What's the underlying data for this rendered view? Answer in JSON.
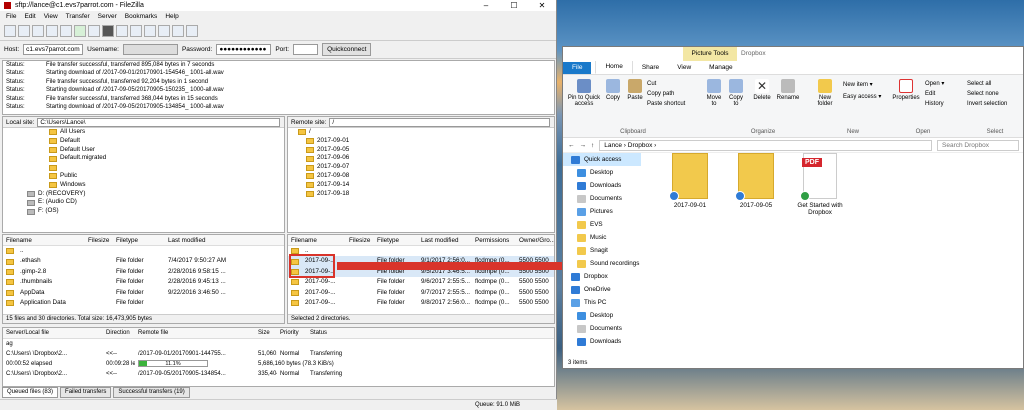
{
  "filezilla": {
    "title": "sftp://lance@c1.evs7parrot.com - FileZilla",
    "menu": [
      "File",
      "Edit",
      "View",
      "Transfer",
      "Server",
      "Bookmarks",
      "Help"
    ],
    "quickconnect": {
      "host_label": "Host:",
      "host": "c1.evs7parrot.com",
      "user_label": "Username:",
      "user": "",
      "pass_label": "Password:",
      "pass": "●●●●●●●●●●●●",
      "port_label": "Port:",
      "port": "",
      "button": "Quickconnect"
    },
    "log": [
      {
        "k": "Status:",
        "v": "File transfer successful, transferred 895,084 bytes in 7 seconds"
      },
      {
        "k": "Status:",
        "v": "Starting download of /2017-09-01/20170901-154546_          1001-all.wav"
      },
      {
        "k": "Status:",
        "v": "File transfer successful, transferred 92,204 bytes in 1 second"
      },
      {
        "k": "Status:",
        "v": "Starting download of /2017-09-05/20170905-150235_          1000-all.wav"
      },
      {
        "k": "Status:",
        "v": "File transfer successful, transferred 368,044 bytes in 15 seconds"
      },
      {
        "k": "Status:",
        "v": "Starting download of /2017-09-05/20170905-134854_          1000-all.wav"
      }
    ],
    "local": {
      "site_label": "Local site:",
      "site_path": "C:\\Users\\Lance\\",
      "tree": [
        "All Users",
        "Default",
        "Default User",
        "Default.migrated",
        "",
        "Public",
        "Windows",
        "D: (RECOVERY)",
        "E: (Audio CD)",
        "F: (OS)"
      ],
      "headers": [
        "Filename",
        "Filesize",
        "Filetype",
        "Last modified"
      ],
      "files": [
        {
          "name": "..",
          "size": "",
          "type": "",
          "mod": ""
        },
        {
          "name": ".ethash",
          "size": "",
          "type": "File folder",
          "mod": "7/4/2017 9:50:27 AM"
        },
        {
          "name": ".gimp-2.8",
          "size": "",
          "type": "File folder",
          "mod": "2/28/2016 9:58:15 ..."
        },
        {
          "name": ".thumbnails",
          "size": "",
          "type": "File folder",
          "mod": "2/28/2016 9:45:13 ..."
        },
        {
          "name": "AppData",
          "size": "",
          "type": "File folder",
          "mod": "9/22/2016 3:46:50 ..."
        },
        {
          "name": "Application Data",
          "size": "",
          "type": "File folder",
          "mod": ""
        }
      ],
      "status": "15 files and 30 directories. Total size: 16,473,905 bytes"
    },
    "remote": {
      "site_label": "Remote site:",
      "site_path": "/",
      "tree": [
        "/",
        "2017-09-01",
        "2017-09-05",
        "2017-09-06",
        "2017-09-07",
        "2017-09-08",
        "2017-09-14",
        "2017-09-18"
      ],
      "headers": [
        "Filename",
        "Filesize",
        "Filetype",
        "Last modified",
        "Permissions",
        "Owner/Gro..."
      ],
      "files": [
        {
          "name": "..",
          "size": "",
          "type": "",
          "mod": "",
          "perm": "",
          "own": ""
        },
        {
          "name": "2017-09-...",
          "size": "",
          "type": "File folder",
          "mod": "9/1/2017 2:56:0...",
          "perm": "flcdmpe (0...",
          "own": "5500 5500"
        },
        {
          "name": "2017-09-...",
          "size": "",
          "type": "File folder",
          "mod": "9/5/2017 3:46:5...",
          "perm": "flcdmpe (0...",
          "own": "5500 5500"
        },
        {
          "name": "2017-09-...",
          "size": "",
          "type": "File folder",
          "mod": "9/6/2017 2:55:5...",
          "perm": "flcdmpe (0...",
          "own": "5500 5500"
        },
        {
          "name": "2017-09-...",
          "size": "",
          "type": "File folder",
          "mod": "9/7/2017 2:55:5...",
          "perm": "flcdmpe (0...",
          "own": "5500 5500"
        },
        {
          "name": "2017-09-...",
          "size": "",
          "type": "File folder",
          "mod": "9/8/2017 2:56:0...",
          "perm": "flcdmpe (0...",
          "own": "5500 5500"
        }
      ],
      "status": "Selected 2 directories."
    },
    "queue": {
      "headers": [
        "Server/Local file",
        "Direction",
        "Remote file",
        "Size",
        "Priority",
        "Status"
      ],
      "rows": [
        {
          "local": "ag",
          "dir": "",
          "remote": "",
          "size": "",
          "prio": "",
          "status": ""
        },
        {
          "local": "C:\\Users\\      \\Dropbox\\2...",
          "dir": "<<--",
          "remote": "/2017-09-01/20170901-144755...",
          "size": "51,060,524",
          "prio": "Normal",
          "status": "Transferring"
        },
        {
          "local": "00:00:52 elapsed",
          "dir": "00:09:28 left",
          "remote": "",
          "size": "5,686,160 bytes (78.3 KiB/s)",
          "prio": "",
          "status": ""
        },
        {
          "local": "C:\\Users\\      \\Dropbox\\2...",
          "dir": "<<--",
          "remote": "/2017-09-05/20170905-134854...",
          "size": "335,404",
          "prio": "Normal",
          "status": "Transferring"
        }
      ],
      "progress": {
        "label": "11.1%",
        "fraction": 0.111
      }
    },
    "queue_tabs": [
      "Queued files (83)",
      "Failed transfers",
      "Successful transfers (19)"
    ],
    "queue_status": "Queue: 91.0 MiB"
  },
  "explorer": {
    "context_tab": "Picture Tools",
    "title": "Dropbox",
    "tabs": [
      "File",
      "Home",
      "Share",
      "View",
      "Manage"
    ],
    "ribbon": {
      "pin": "Pin to Quick access",
      "copy": "Copy",
      "paste": "Paste",
      "cut": "Cut",
      "copy_path": "Copy path",
      "paste_shortcut": "Paste shortcut",
      "clipboard": "Clipboard",
      "move_to": "Move to",
      "copy_to": "Copy to",
      "delete": "Delete",
      "rename": "Rename",
      "organize": "Organize",
      "new_folder": "New folder",
      "new_item": "New item ▾",
      "easy_access": "Easy access ▾",
      "new": "New",
      "properties": "Properties",
      "open": "Open ▾",
      "edit": "Edit",
      "history": "History",
      "open_group": "Open",
      "select_all": "Select all",
      "select_none": "Select none",
      "invert": "Invert selection",
      "select": "Select"
    },
    "address": [
      "Lance",
      "Dropbox"
    ],
    "search": "Search Dropbox",
    "nav": [
      "Quick access",
      "Desktop",
      "Downloads",
      "Documents",
      "Pictures",
      "EVS",
      "Music",
      "Snagit",
      "Sound recordings",
      "Dropbox",
      "OneDrive",
      "This PC",
      "Desktop",
      "Documents",
      "Downloads"
    ],
    "files": [
      {
        "name": "2017-09-01"
      },
      {
        "name": "2017-09-05"
      },
      {
        "name": "Get Started with Dropbox",
        "tag": "PDF"
      }
    ],
    "status": "3 items"
  }
}
